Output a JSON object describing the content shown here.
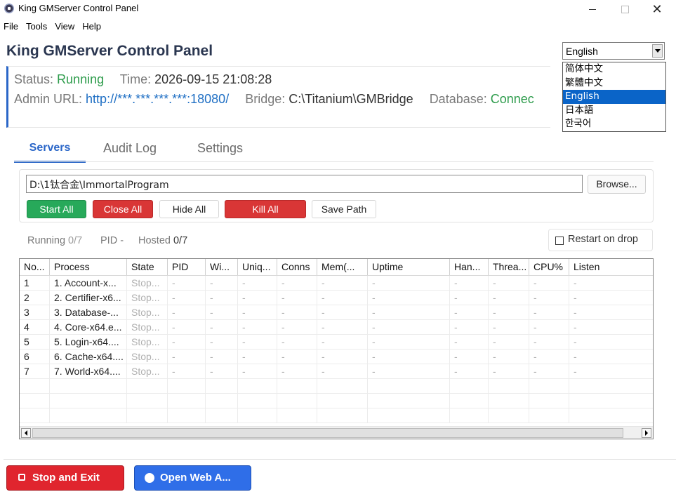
{
  "window": {
    "title": "King GMServer Control Panel",
    "min_icon": "minimize-icon",
    "max_icon": "maximize-icon",
    "close_glyph": "✕"
  },
  "menu": [
    "File",
    "Tools",
    "View",
    "Help"
  ],
  "header": {
    "title": "King GMServer Control Panel"
  },
  "language": {
    "selected": "English",
    "options": [
      "简体中文",
      "繁體中文",
      "English",
      "日本語",
      "한국어"
    ]
  },
  "status": {
    "status_label": "Status:",
    "status_value": "Running",
    "time_label": "Time:",
    "time_value": "2026-09-15 21:08:28",
    "admin_url_label": "Admin URL:",
    "admin_url_value": "http://***.***.***.***:18080/",
    "bridge_label": "Bridge:",
    "bridge_value": "C:\\Titanium\\GMBridge",
    "database_label": "Database:",
    "database_value": "Connec"
  },
  "tabs": [
    "Servers",
    "Audit Log",
    "Settings"
  ],
  "servers": {
    "path_value": "D:\\1钛合金\\ImmortalProgram",
    "browse_label": "Browse...",
    "buttons": {
      "start_all": "Start All",
      "close_all": "Close All",
      "hide_all": "Hide All",
      "kill_all": "Kill All",
      "save_path": "Save Path"
    },
    "summary": {
      "running_label": "Running",
      "running_value": "0/7",
      "pid_label": "PID",
      "pid_value": "-",
      "hosted_label": "Hosted",
      "hosted_value": "0/7"
    },
    "restart_on_drop_label": "Restart on drop",
    "restart_on_drop_checked": false,
    "grid": {
      "columns": [
        "No...",
        "Process",
        "State",
        "PID",
        "Wi...",
        "Uniq...",
        "Conns",
        "Mem(...",
        "Uptime",
        "Han...",
        "Threa...",
        "CPU%",
        "Listen"
      ],
      "rows": [
        [
          "1",
          "1. Account-x...",
          "Stop...",
          "-",
          "-",
          "-",
          "-",
          "-",
          "-",
          "-",
          "-",
          "-",
          "-"
        ],
        [
          "2",
          "2. Certifier-x6...",
          "Stop...",
          "-",
          "-",
          "-",
          "-",
          "-",
          "-",
          "-",
          "-",
          "-",
          "-"
        ],
        [
          "3",
          "3. Database-...",
          "Stop...",
          "-",
          "-",
          "-",
          "-",
          "-",
          "-",
          "-",
          "-",
          "-",
          "-"
        ],
        [
          "4",
          "4. Core-x64.e...",
          "Stop...",
          "-",
          "-",
          "-",
          "-",
          "-",
          "-",
          "-",
          "-",
          "-",
          "-"
        ],
        [
          "5",
          "5. Login-x64....",
          "Stop...",
          "-",
          "-",
          "-",
          "-",
          "-",
          "-",
          "-",
          "-",
          "-",
          "-"
        ],
        [
          "6",
          "6. Cache-x64....",
          "Stop...",
          "-",
          "-",
          "-",
          "-",
          "-",
          "-",
          "-",
          "-",
          "-",
          "-"
        ],
        [
          "7",
          "7. World-x64....",
          "Stop...",
          "-",
          "-",
          "-",
          "-",
          "-",
          "-",
          "-",
          "-",
          "-",
          "-"
        ]
      ]
    }
  },
  "footer": {
    "stop_exit_label": "Stop and Exit",
    "open_web_label": "Open Web A..."
  },
  "colors": {
    "accent_blue": "#2a66c8",
    "running_green": "#2e9c4c",
    "danger_red": "#d93636",
    "start_green": "#27a95a"
  }
}
